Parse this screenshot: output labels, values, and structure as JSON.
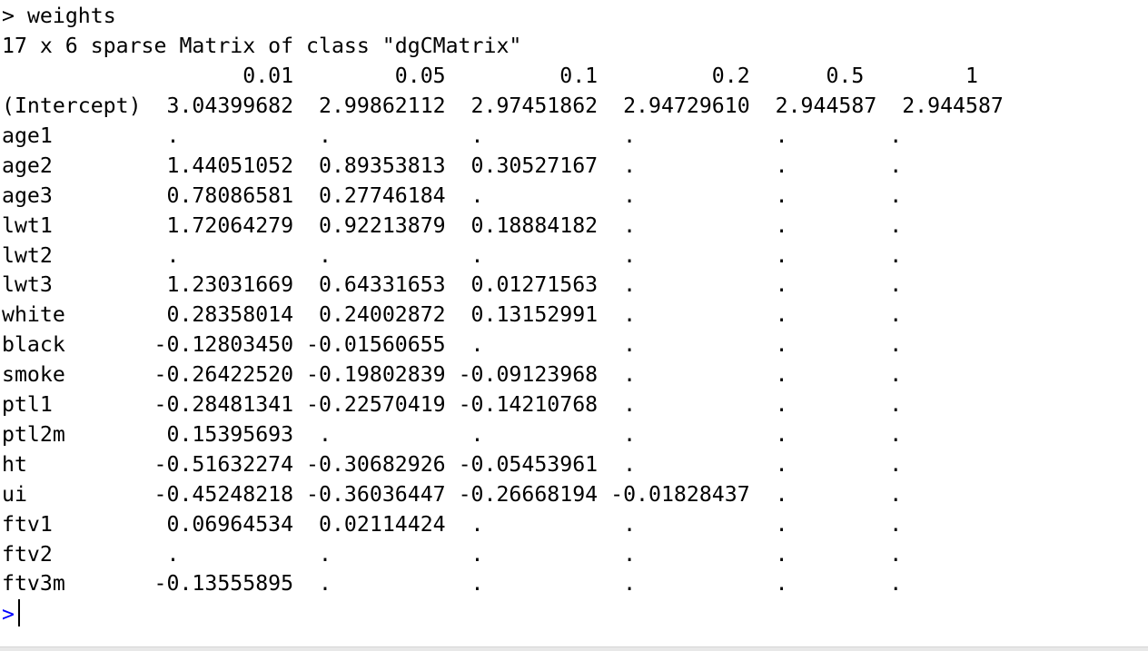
{
  "console": {
    "command": {
      "prompt": ">",
      "text": "weights"
    },
    "description": "17 x 6 sparse Matrix of class \"dgCMatrix\"",
    "matrix": {
      "columns": [
        "0.01",
        "0.05",
        "0.1",
        "0.2",
        "0.5",
        "1"
      ],
      "rows": [
        {
          "name": "(Intercept)",
          "values": [
            "3.04399682",
            "2.99862112",
            "2.97451862",
            "2.94729610",
            "2.944587",
            "2.944587"
          ]
        },
        {
          "name": "age1",
          "values": [
            ".",
            ".",
            ".",
            ".",
            ".",
            "."
          ]
        },
        {
          "name": "age2",
          "values": [
            "1.44051052",
            "0.89353813",
            "0.30527167",
            ".",
            ".",
            "."
          ]
        },
        {
          "name": "age3",
          "values": [
            "0.78086581",
            "0.27746184",
            ".",
            ".",
            ".",
            "."
          ]
        },
        {
          "name": "lwt1",
          "values": [
            "1.72064279",
            "0.92213879",
            "0.18884182",
            ".",
            ".",
            "."
          ]
        },
        {
          "name": "lwt2",
          "values": [
            ".",
            ".",
            ".",
            ".",
            ".",
            "."
          ]
        },
        {
          "name": "lwt3",
          "values": [
            "1.23031669",
            "0.64331653",
            "0.01271563",
            ".",
            ".",
            "."
          ]
        },
        {
          "name": "white",
          "values": [
            "0.28358014",
            "0.24002872",
            "0.13152991",
            ".",
            ".",
            "."
          ]
        },
        {
          "name": "black",
          "values": [
            "-0.12803450",
            "-0.01560655",
            ".",
            ".",
            ".",
            "."
          ]
        },
        {
          "name": "smoke",
          "values": [
            "-0.26422520",
            "-0.19802839",
            "-0.09123968",
            ".",
            ".",
            "."
          ]
        },
        {
          "name": "ptl1",
          "values": [
            "-0.28481341",
            "-0.22570419",
            "-0.14210768",
            ".",
            ".",
            "."
          ]
        },
        {
          "name": "ptl2m",
          "values": [
            "0.15395693",
            ".",
            ".",
            ".",
            ".",
            "."
          ]
        },
        {
          "name": "ht",
          "values": [
            "-0.51632274",
            "-0.30682926",
            "-0.05453961",
            ".",
            ".",
            "."
          ]
        },
        {
          "name": "ui",
          "values": [
            "-0.45248218",
            "-0.36036447",
            "-0.26668194",
            "-0.01828437",
            ".",
            "."
          ]
        },
        {
          "name": "ftv1",
          "values": [
            "0.06964534",
            "0.02114424",
            ".",
            ".",
            ".",
            "."
          ]
        },
        {
          "name": "ftv2",
          "values": [
            ".",
            ".",
            ".",
            ".",
            ".",
            "."
          ]
        },
        {
          "name": "ftv3m",
          "values": [
            "-0.13555895",
            ".",
            ".",
            ".",
            ".",
            "."
          ]
        }
      ]
    },
    "input_prompt": ">",
    "colors": {
      "prompt": "#0000ff",
      "text": "#000000",
      "background": "#ffffff"
    }
  }
}
